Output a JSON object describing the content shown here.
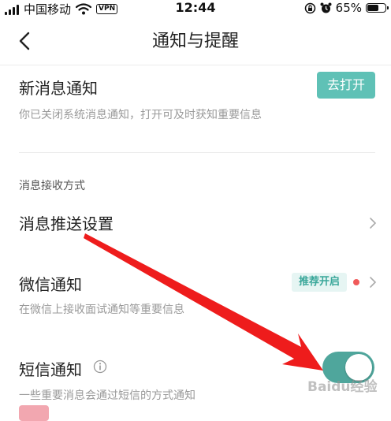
{
  "status_bar": {
    "carrier": "中国移动",
    "vpn": "VPN",
    "time": "12:44",
    "battery": "65%",
    "battery_level": 0.65
  },
  "navbar": {
    "title": "通知与提醒"
  },
  "new_message": {
    "title": "新消息通知",
    "description": "你已关闭系统消息通知，打开可及时获知重要信息",
    "button_label": "去打开"
  },
  "receive_section": {
    "label": "消息接收方式"
  },
  "push_settings": {
    "title": "消息推送设置"
  },
  "wechat": {
    "title": "微信通知",
    "badge": "推荐开启",
    "description": "在微信上接收面试通知等重要信息"
  },
  "sms": {
    "title": "短信通知",
    "description": "一些重要消息会通过短信的方式通知",
    "enabled": true
  },
  "watermark": "Baidu经验",
  "colors": {
    "accent": "#5fc1b6",
    "toggle_on": "#4fa69c",
    "arrow": "#ee1c1c",
    "dot": "#f05a5a"
  }
}
